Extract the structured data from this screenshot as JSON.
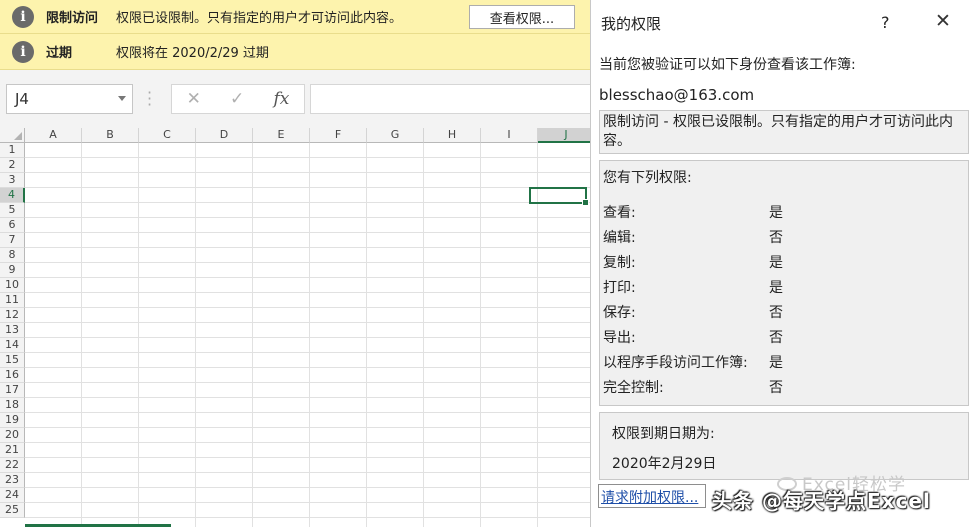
{
  "infobars": [
    {
      "title": "限制访问",
      "message": "权限已设限制。只有指定的用户才可访问此内容。",
      "button": "查看权限..."
    },
    {
      "title": "过期",
      "message": "权限将在 2020/2/29 过期"
    }
  ],
  "formula_bar": {
    "name_box": "J4",
    "cancel_icon": "✕",
    "enter_icon": "✓",
    "fx_label": "fx"
  },
  "grid": {
    "columns": [
      "A",
      "B",
      "C",
      "D",
      "E",
      "F",
      "G",
      "H",
      "I",
      "J"
    ],
    "rows": [
      "1",
      "2",
      "3",
      "4",
      "5",
      "6",
      "7",
      "8",
      "9",
      "10",
      "11",
      "12",
      "13",
      "14",
      "15",
      "16",
      "17",
      "18",
      "19",
      "20",
      "21",
      "22",
      "23",
      "24",
      "25"
    ],
    "selected_column": "J",
    "selected_row": "4"
  },
  "pane": {
    "title": "我的权限",
    "help": "?",
    "close": "✕",
    "intro": "当前您被验证可以如下身份查看该工作簿:",
    "email": "blesschao@163.com",
    "restriction_note": "限制访问 - 权限已设限制。只有指定的用户才可访问此内容。",
    "permissions_header": "您有下列权限:",
    "permissions": [
      {
        "label": "查看:",
        "value": "是"
      },
      {
        "label": "编辑:",
        "value": "否"
      },
      {
        "label": "复制:",
        "value": "是"
      },
      {
        "label": "打印:",
        "value": "是"
      },
      {
        "label": "保存:",
        "value": "否"
      },
      {
        "label": "导出:",
        "value": "否"
      },
      {
        "label": "以程序手段访问工作簿:",
        "value": "是"
      },
      {
        "label": "完全控制:",
        "value": "否"
      }
    ],
    "expiry_label": "权限到期日期为:",
    "expiry_value": "2020年2月29日",
    "request_link": "请求附加权限..."
  },
  "watermark": {
    "line1": "Excel轻松学",
    "line2": "头条 @每天学点Excel"
  },
  "colors": {
    "infobar_bg": "#fdf3ad",
    "excel_green": "#217346",
    "pane_box_bg": "#f0f0f0"
  }
}
